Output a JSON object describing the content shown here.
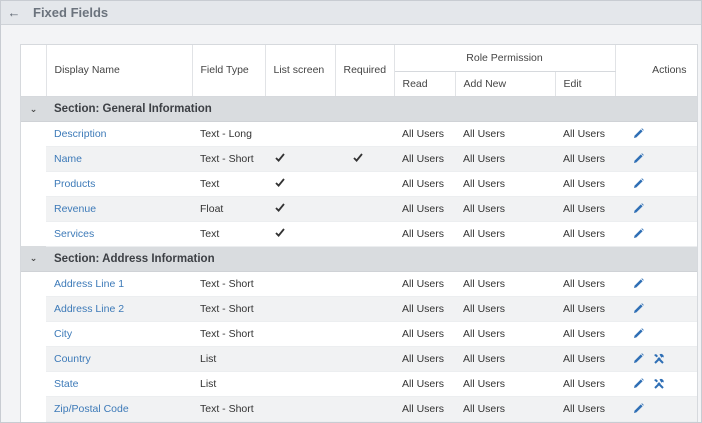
{
  "header": {
    "title": "Fixed Fields"
  },
  "table": {
    "columns": {
      "display_name": "Display Name",
      "field_type": "Field Type",
      "list_screen": "List screen",
      "required": "Required",
      "role_permission": "Role Permission",
      "read": "Read",
      "add_new": "Add New",
      "edit": "Edit",
      "actions": "Actions"
    },
    "sections": [
      {
        "title": "Section: General Information",
        "rows": [
          {
            "name": "Description",
            "type": "Text - Long",
            "list": false,
            "required": false,
            "read": "All Users",
            "add_new": "All Users",
            "edit": "All Users",
            "settings": false
          },
          {
            "name": "Name",
            "type": "Text - Short",
            "list": true,
            "required": true,
            "read": "All Users",
            "add_new": "All Users",
            "edit": "All Users",
            "settings": false
          },
          {
            "name": "Products",
            "type": "Text",
            "list": true,
            "required": false,
            "read": "All Users",
            "add_new": "All Users",
            "edit": "All Users",
            "settings": false
          },
          {
            "name": "Revenue",
            "type": "Float",
            "list": true,
            "required": false,
            "read": "All Users",
            "add_new": "All Users",
            "edit": "All Users",
            "settings": false
          },
          {
            "name": "Services",
            "type": "Text",
            "list": true,
            "required": false,
            "read": "All Users",
            "add_new": "All Users",
            "edit": "All Users",
            "settings": false
          }
        ]
      },
      {
        "title": "Section: Address Information",
        "rows": [
          {
            "name": "Address Line 1",
            "type": "Text - Short",
            "list": false,
            "required": false,
            "read": "All Users",
            "add_new": "All Users",
            "edit": "All Users",
            "settings": false
          },
          {
            "name": "Address Line 2",
            "type": "Text - Short",
            "list": false,
            "required": false,
            "read": "All Users",
            "add_new": "All Users",
            "edit": "All Users",
            "settings": false
          },
          {
            "name": "City",
            "type": "Text - Short",
            "list": false,
            "required": false,
            "read": "All Users",
            "add_new": "All Users",
            "edit": "All Users",
            "settings": false
          },
          {
            "name": "Country",
            "type": "List",
            "list": false,
            "required": false,
            "read": "All Users",
            "add_new": "All Users",
            "edit": "All Users",
            "settings": true
          },
          {
            "name": "State",
            "type": "List",
            "list": false,
            "required": false,
            "read": "All Users",
            "add_new": "All Users",
            "edit": "All Users",
            "settings": true
          },
          {
            "name": "Zip/Postal Code",
            "type": "Text - Short",
            "list": false,
            "required": false,
            "read": "All Users",
            "add_new": "All Users",
            "edit": "All Users",
            "settings": false
          }
        ]
      }
    ]
  },
  "icons": {
    "back": "arrow-left-icon",
    "collapse": "chevron-down-icon",
    "check": "checkmark-icon",
    "edit": "pencil-icon",
    "settings": "tools-icon"
  },
  "colors": {
    "link": "#3d7ab8",
    "section_bg": "#d9dcdf",
    "alt_row_bg": "#f1f2f3",
    "edit_icon": "#2f6fb5",
    "tools_icon": "#2f6fb5"
  }
}
